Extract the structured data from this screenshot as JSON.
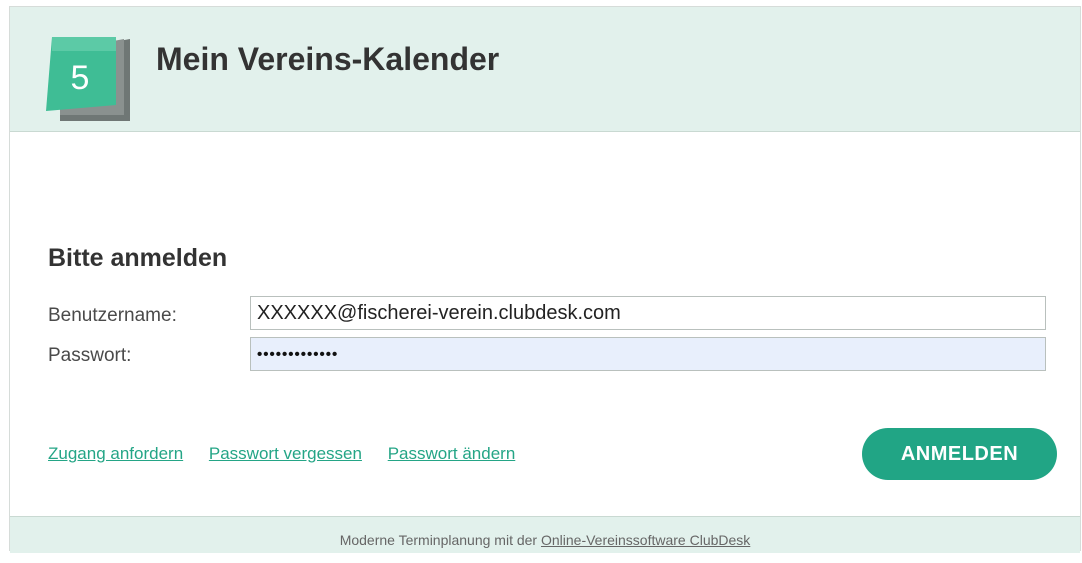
{
  "header": {
    "logo_number": "5",
    "title": "Mein Vereins-Kalender"
  },
  "login": {
    "heading": "Bitte anmelden",
    "username_label": "Benutzername:",
    "username_value": "XXXXXX@fischerei-verein.clubdesk.com",
    "password_label": "Passwort:",
    "password_value": "•••••••••••••",
    "submit_label": "ANMELDEN"
  },
  "links": {
    "request_access": "Zugang anfordern",
    "forgot_password": "Passwort vergessen",
    "change_password": "Passwort ändern"
  },
  "footer": {
    "text": "Moderne Terminplanung mit der",
    "link": "Online-Vereinssoftware ClubDesk"
  },
  "colors": {
    "accent": "#21a585",
    "header_bg": "#e2f1ec",
    "password_field_bg": "#e8effc"
  },
  "icons": {
    "logo": "calendar-page-icon"
  }
}
